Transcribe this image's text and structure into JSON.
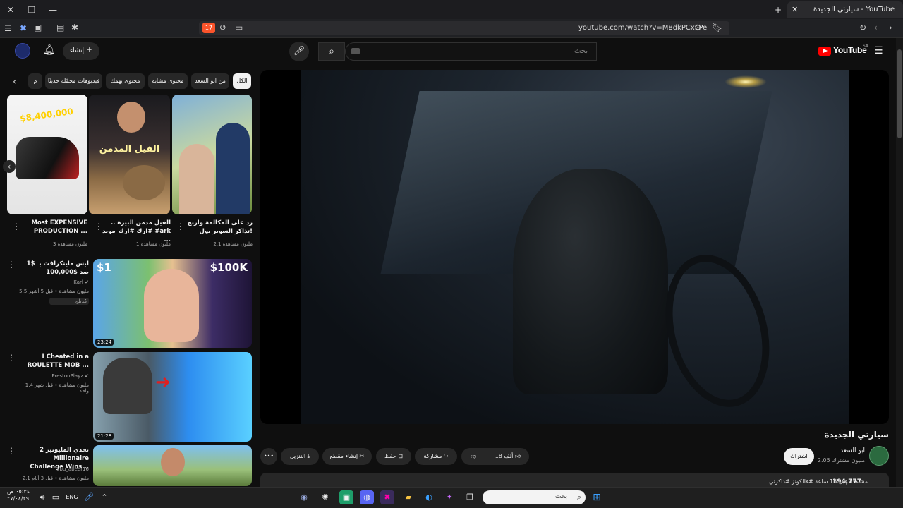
{
  "browser": {
    "tab_title": "سيارتي الجديدة - YouTube",
    "url": "youtube.com/watch?v=M8dkPCxLPel",
    "badge_count": "17"
  },
  "header": {
    "search_placeholder": "بحث",
    "create_label": "إنشاء",
    "logo_text": "YouTube",
    "country_code": "SA"
  },
  "chips": [
    {
      "label": "الكل",
      "active": true
    },
    {
      "label": "من ابو السعد"
    },
    {
      "label": "محتوى مشابه"
    },
    {
      "label": "محتوى يهمك"
    },
    {
      "label": "فيديوهات محمّلة حديثًا"
    },
    {
      "label": "م"
    }
  ],
  "shorts": [
    {
      "title": "رد على المكالمة واربح تذاكر السوبر بول!",
      "views": "2.1 مليون مشاهدة",
      "thumb_text": ""
    },
    {
      "title": "الفيل مدمن البيرة .. #ارك #ارك_موبد #ark ...",
      "views": "1 مليون مشاهدة",
      "thumb_text": "الفيل المدمن"
    },
    {
      "title": "Most EXPENSIVE PRODUCTION ...",
      "views": "3 مليون مشاهدة",
      "thumb_text": "$8,400,000"
    }
  ],
  "videos": [
    {
      "title": "ليس ماينكرافت بـ $1 ضد $100,000",
      "channel": "Karl",
      "meta": "5.5 مليون مشاهدة • قبل 5 أشهر",
      "badge": "مُدبلج",
      "duration": "23:24",
      "thumb_left": "$1",
      "thumb_right": "$100K"
    },
    {
      "title": "I Cheated in a ROULETTE MOB ...",
      "channel": "PrestonPlayz",
      "meta": "1.4 مليون مشاهدة • قبل شهر واحد",
      "badge": "",
      "duration": "21:28"
    },
    {
      "title": "تحدي المليونير 2 Millionaire Challenge Wins...",
      "channel": "abu_abeer16",
      "meta": "2.1 مليون مشاهدة • قبل 3 أيام",
      "badge": "",
      "duration": ""
    }
  ],
  "video": {
    "title": "سيارتي الجديدة",
    "channel": "ابو السعد",
    "subscribers": "2.05 مليون مشترك",
    "subscribe_label": "اشتراك",
    "likes": "18 ألف",
    "share_label": "مشاركة",
    "save_label": "حفظ",
    "clip_label": "إنشاء مقطع",
    "download_label": "التنزيل",
    "views": "194,777",
    "views_meta": "مشاهدة قبل 16 ساعة #فالكونز #ذاكرتي"
  },
  "taskbar": {
    "search_placeholder": "بحث",
    "language": "ENG",
    "time": "٠٥:٣٤ ص",
    "date": "٢٧/٠٨/٢٩"
  },
  "colors": {
    "youtube_red": "#ff0000",
    "background": "#0f0f0f"
  }
}
